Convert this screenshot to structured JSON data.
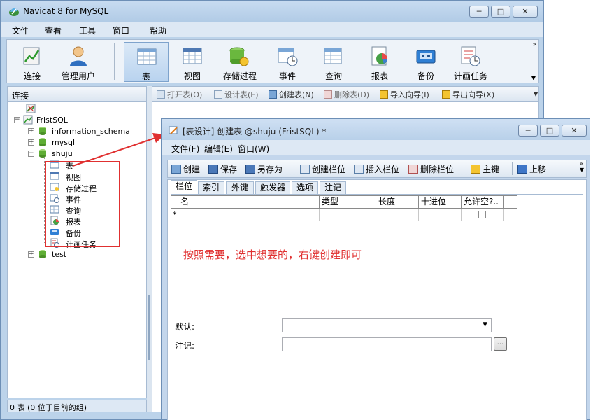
{
  "main_window": {
    "title": "Navicat 8 for MySQL",
    "controls": {
      "minimize": "─",
      "maximize": "□",
      "close": "✕"
    },
    "menu": [
      "文件",
      "查看",
      "工具",
      "窗口",
      "帮助"
    ],
    "toolbar": [
      {
        "label": "连接",
        "icon": "connect-icon"
      },
      {
        "label": "管理用户",
        "icon": "user-icon"
      },
      {
        "label": "表",
        "icon": "table-icon",
        "active": true
      },
      {
        "label": "视图",
        "icon": "view-icon"
      },
      {
        "label": "存储过程",
        "icon": "procedure-icon"
      },
      {
        "label": "事件",
        "icon": "event-icon"
      },
      {
        "label": "查询",
        "icon": "query-icon"
      },
      {
        "label": "报表",
        "icon": "report-icon"
      },
      {
        "label": "备份",
        "icon": "backup-icon"
      },
      {
        "label": "计画任务",
        "icon": "schedule-icon"
      }
    ],
    "toolbar_more": "»",
    "left_header": "连接",
    "tree": {
      "connection": "FristSQL",
      "databases": [
        "information_schema",
        "mysql",
        "shuju",
        "test"
      ],
      "shuju_children": [
        "表",
        "视图",
        "存储过程",
        "事件",
        "查询",
        "报表",
        "备份",
        "计画任务"
      ]
    },
    "status": "0 表 (0 位于目前的组)",
    "object_toolbar": [
      {
        "label": "打开表(O)",
        "enabled": false
      },
      {
        "label": "设计表(E)",
        "enabled": false
      },
      {
        "label": "创建表(N)",
        "enabled": true
      },
      {
        "label": "删除表(D)",
        "enabled": false
      },
      {
        "label": "导入向导(I)",
        "enabled": true
      },
      {
        "label": "导出向导(X)",
        "enabled": true
      }
    ]
  },
  "child_window": {
    "title": "[表设计] 创建表 @shuju (FristSQL) *",
    "menu": [
      "文件(F)",
      "编辑(E)",
      "窗口(W)"
    ],
    "toolbar": [
      "创建",
      "保存",
      "另存为",
      "创建栏位",
      "插入栏位",
      "删除栏位",
      "主键",
      "上移"
    ],
    "tabs": [
      "栏位",
      "索引",
      "外键",
      "触发器",
      "选项",
      "注记"
    ],
    "columns": [
      "名",
      "类型",
      "长度",
      "十进位",
      "允许空?.."
    ],
    "new_row_marker": "*",
    "annotation": "按照需要，选中想要的，右键创建即可",
    "default_label": "默认:",
    "default_value": "",
    "comment_label": "注记:",
    "comment_value": "",
    "ellipsis": "..."
  },
  "colors": {
    "annotation": "#e03030",
    "arrow": "#e03030",
    "frame": "#bcd3ea"
  }
}
